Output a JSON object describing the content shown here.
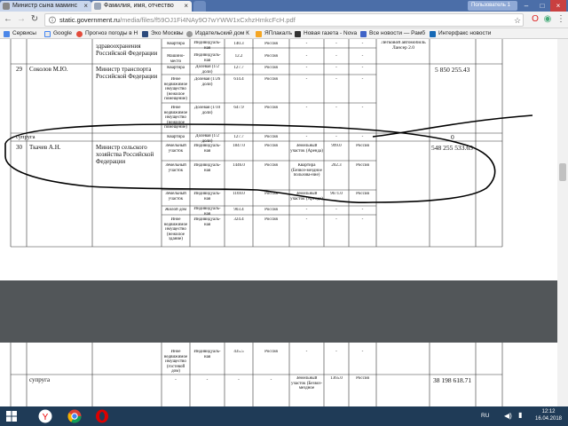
{
  "browser": {
    "tabs": [
      {
        "title": "Министр сына маминс",
        "active": false
      },
      {
        "title": "Фамилия, имя, отчество",
        "active": true
      }
    ],
    "user": "Пользователь 1",
    "url_host": "static.government.ru",
    "url_path": "/media/files/f59OJ1Fi4NAy9O7wYWW1xCxhzHmkcFcH.pdf",
    "bookmarks": [
      "Сервисы",
      "Google",
      "Прогноз погоды в Н",
      "Эхо Москвы",
      "Издательский дом К",
      "ЯПлакалъ",
      "Новая газета - Nova",
      "Все новости — Рамб",
      "Интерфакс новости"
    ]
  },
  "document": {
    "page1": {
      "top_rows": [
        {
          "type": "Квартира",
          "ownership": "Индивидуаль-ная",
          "area": "140.3",
          "country": "Россия"
        },
        {
          "type": "Машино-место",
          "ownership": "Индивидуаль-ная",
          "area": "12.2",
          "country": "Россия"
        }
      ],
      "top_post_tail": "здравоохранения Российской Федерации",
      "top_vehicle": "Легковой автомобиль Лансер 2.0",
      "sokolov": {
        "num": "29",
        "name": "Соколов М.Ю.",
        "post": "Министр транспорта Российской Федерации",
        "income": "5 850 255.43",
        "rows": [
          {
            "type": "Квартира",
            "ownership": "Долевая (1/2 доли)",
            "area": "127.7",
            "country": "Россия"
          },
          {
            "type": "Иное недвижимое имущество (нежилое помещение)",
            "ownership": "Долевая (1/26 доли)",
            "area": "614.4",
            "country": "Россия"
          },
          {
            "type": "Иное недвижимое имущество (нежилое помещение)",
            "ownership": "Долевая (1/10 доли)",
            "area": "647.9",
            "country": "Россия"
          }
        ]
      },
      "spouse_row": {
        "label": "супруга",
        "type": "Квартира",
        "ownership": "Долевая (1/2 доли)",
        "area": "127.7",
        "country": "Россия",
        "income": "0"
      },
      "tkachev": {
        "num": "30",
        "name": "Ткачев А.Н.",
        "post": "Министр сельского хозяйства Российской Федерации",
        "income": "548 255 533.63",
        "rows": [
          {
            "type": "Земельный участок",
            "ownership": "Индивидуаль-ная",
            "area": "1847.0",
            "country": "Россия",
            "use_type": "Земельный участок (Аренда)",
            "use_area": "999.0",
            "use_country": "Россия"
          },
          {
            "type": "Земельный участок",
            "ownership": "Индивидуаль-ная",
            "area": "1446.0",
            "country": "Россия",
            "use_type": "Квартира (Безвоз-мездное пользова-ние)",
            "use_area": "202.3",
            "use_country": "Россия"
          },
          {
            "type": "Земельный участок",
            "ownership": "Индивидуаль-ная",
            "area": "1169.0",
            "country": "Россия",
            "use_type": "Земельный участок (Аренда)",
            "use_area": "9671.0",
            "use_country": "Россия"
          },
          {
            "type": "Жилой дом",
            "ownership": "Индивидуаль-ная",
            "area": "903.4",
            "country": "Россия",
            "use_type": "-",
            "use_area": "-",
            "use_country": "-"
          },
          {
            "type": "Иное недвижимое имущество (нежилое здание)",
            "ownership": "Индивидуаль-ная",
            "area": "324.4",
            "country": "Россия",
            "use_type": "-",
            "use_area": "-",
            "use_country": "-"
          }
        ]
      },
      "dash": "-"
    },
    "page2": {
      "row1": {
        "type": "Иное недвижимое имущество (гостевой дом)",
        "ownership": "Индивидуаль-ная",
        "area": "435.5",
        "country": "Россия"
      },
      "spouse": {
        "label": "супруга",
        "dash": "-",
        "use_type": "Земельный участок (Безвоз-мездное",
        "use_area": "1365.0",
        "use_country": "Россия",
        "income": "38 198 618.71"
      }
    }
  },
  "taskbar": {
    "lang": "RU",
    "time": "12:12",
    "date": "16.04.2018"
  },
  "colors": {
    "taskbar": "#1f3b57",
    "tabbar": "#4b6ea8",
    "viewer_bg": "#525659"
  }
}
